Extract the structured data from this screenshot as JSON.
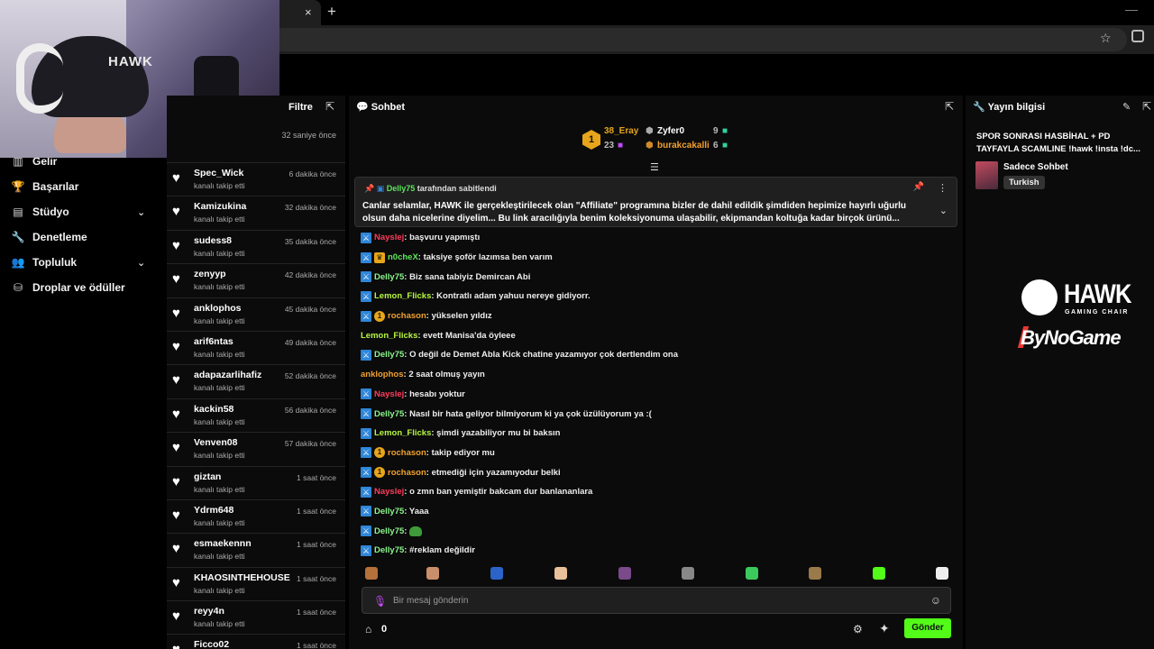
{
  "browser": {
    "new_tab_symbol": "+",
    "close_symbol": "×"
  },
  "left_nav": [
    {
      "label": "Gelir",
      "icon": "chart-icon",
      "glyph": "▥",
      "has_chevron": false
    },
    {
      "label": "Başarılar",
      "icon": "trophy-icon",
      "glyph": "🏆",
      "has_chevron": false
    },
    {
      "label": "Stüdyo",
      "icon": "studio-icon",
      "glyph": "▤",
      "has_chevron": true
    },
    {
      "label": "Denetleme",
      "icon": "wrench-icon",
      "glyph": "🔧",
      "has_chevron": false
    },
    {
      "label": "Topluluk",
      "icon": "community-icon",
      "glyph": "👥",
      "has_chevron": true
    },
    {
      "label": "Droplar ve ödüller",
      "icon": "drops-icon",
      "glyph": "⛁",
      "has_chevron": false
    }
  ],
  "followers": {
    "filter_label": "Filtre",
    "first_time": "32 saniye önce",
    "items": [
      {
        "name": "Spec_Wick",
        "action": "kanalı takip etti",
        "time": "6 dakika önce"
      },
      {
        "name": "Kamizukina",
        "action": "kanalı takip etti",
        "time": "32 dakika önce"
      },
      {
        "name": "sudess8",
        "action": "kanalı takip etti",
        "time": "35 dakika önce"
      },
      {
        "name": "zenyyp",
        "action": "kanalı takip etti",
        "time": "42 dakika önce"
      },
      {
        "name": "anklophos",
        "action": "kanalı takip etti",
        "time": "45 dakika önce"
      },
      {
        "name": "arif6ntas",
        "action": "kanalı takip etti",
        "time": "49 dakika önce"
      },
      {
        "name": "adapazarlihafiz",
        "action": "kanalı takip etti",
        "time": "52 dakika önce"
      },
      {
        "name": "kackin58",
        "action": "kanalı takip etti",
        "time": "56 dakika önce"
      },
      {
        "name": "Venven08",
        "action": "kanalı takip etti",
        "time": "57 dakika önce"
      },
      {
        "name": "giztan",
        "action": "kanalı takip etti",
        "time": "1 saat önce"
      },
      {
        "name": "Ydrm648",
        "action": "kanalı takip etti",
        "time": "1 saat önce"
      },
      {
        "name": "esmaekennn",
        "action": "kanalı takip etti",
        "time": "1 saat önce"
      },
      {
        "name": "KHAOSINTHEHOUSE",
        "action": "kanalı takip etti",
        "time": "1 saat önce"
      },
      {
        "name": "reyy4n",
        "action": "kanalı takip etti",
        "time": "1 saat önce"
      },
      {
        "name": "Ficco02",
        "action": "",
        "time": "1 saat önce"
      }
    ]
  },
  "chat": {
    "title": "Sohbet",
    "leaderboard": {
      "first": {
        "rank": "1",
        "name": "38_Eray",
        "count": "23"
      },
      "second": {
        "name": "Zyfer0",
        "count": "9"
      },
      "third": {
        "name": "burakcakalli",
        "count": "6"
      }
    },
    "pinned": {
      "user": "Delly75",
      "suffix": " tarafından sabitlendi",
      "text": "Canlar selamlar, HAWK ile gerçekleştirilecek olan \"Affiliate\" programına bizler de dahil edildik şimdiden hepimize hayırlı uğurlu olsun daha nicelerine diyelim... Bu link aracılığıyla benim koleksiyonuma ulaşabilir, ekipmandan koltuğa kadar birçok ürünü..."
    },
    "messages": [
      {
        "user": "Nayslej",
        "color": "#ff3b5c",
        "text": ": başvuru yapmıştı",
        "badges": [
          "sword"
        ]
      },
      {
        "user": "n0cheX",
        "color": "#5ce65c",
        "text": ": taksiye şoför lazımsa ben varım",
        "badges": [
          "sword",
          "crown"
        ]
      },
      {
        "user": "Delly75",
        "color": "#8cf58c",
        "text": ": Biz sana tabiyiz Demircan Abi",
        "badges": [
          "sword"
        ]
      },
      {
        "user": "Lemon_Flicks",
        "color": "#b7f542",
        "text": ": Kontratlı adam yahuu nereye gidiyorr.",
        "badges": [
          "sword"
        ]
      },
      {
        "user": "rochason",
        "color": "#f0a030",
        "text": ": yükselen yıldız",
        "badges": [
          "sword",
          "coin"
        ]
      },
      {
        "user": "Lemon_Flicks",
        "color": "#b7f542",
        "text": ": evett Manisa'da öyleee",
        "badges": []
      },
      {
        "user": "Delly75",
        "color": "#8cf58c",
        "text": ": O değil de Demet Abla Kick chatine yazamıyor çok dertlendim ona",
        "badges": [
          "sword"
        ]
      },
      {
        "user": "anklophos",
        "color": "#f0a030",
        "text": ": 2 saat olmuş yayın",
        "badges": []
      },
      {
        "user": "Nayslej",
        "color": "#ff3b5c",
        "text": ": hesabı yoktur",
        "badges": [
          "sword"
        ]
      },
      {
        "user": "Delly75",
        "color": "#8cf58c",
        "text": ": Nasıl bir hata geliyor bilmiyorum ki ya çok üzülüyorum ya :(",
        "badges": [
          "sword"
        ]
      },
      {
        "user": "Lemon_Flicks",
        "color": "#b7f542",
        "text": ": şimdi yazabiliyor mu bi baksın",
        "badges": [
          "sword"
        ]
      },
      {
        "user": "rochason",
        "color": "#f0a030",
        "text": ": takip ediyor mu",
        "badges": [
          "sword",
          "coin"
        ]
      },
      {
        "user": "rochason",
        "color": "#f0a030",
        "text": ": etmediği için yazamıyodur belki",
        "badges": [
          "sword",
          "coin"
        ]
      },
      {
        "user": "Nayslej",
        "color": "#ff3b5c",
        "text": ": o zmn ban yemiştir bakcam dur banlananlara",
        "badges": [
          "sword"
        ]
      },
      {
        "user": "Delly75",
        "color": "#8cf58c",
        "text": ": Yaaa",
        "badges": [
          "sword"
        ]
      },
      {
        "user": "Delly75",
        "color": "#8cf58c",
        "text": ":",
        "badges": [
          "sword"
        ],
        "emote": true
      },
      {
        "user": "Delly75",
        "color": "#8cf58c",
        "text": ": #reklam değildir",
        "badges": [
          "sword"
        ]
      }
    ],
    "input_placeholder": "Bir mesaj gönderin",
    "points": "0",
    "send_label": "Gönder"
  },
  "stream_info": {
    "title": "Yayın bilgisi",
    "stream_title": "SPOR SONRASI HASBİHAL + PD TAYFAYLA SCAMLINE !hawk !insta !dc...",
    "category": "Sadece Sohbet",
    "language": "Turkish"
  },
  "overlay": {
    "hawk": "HAWK",
    "hawk_sub": "GAMING CHAIR",
    "bynogame": "ByNoGame",
    "cam_logo": "HAWK"
  },
  "colors": {
    "kick_green": "#53fc18",
    "panel_bg": "#0b0b0b",
    "badge_blue": "#2f86d8",
    "gold": "#e6a51b"
  }
}
